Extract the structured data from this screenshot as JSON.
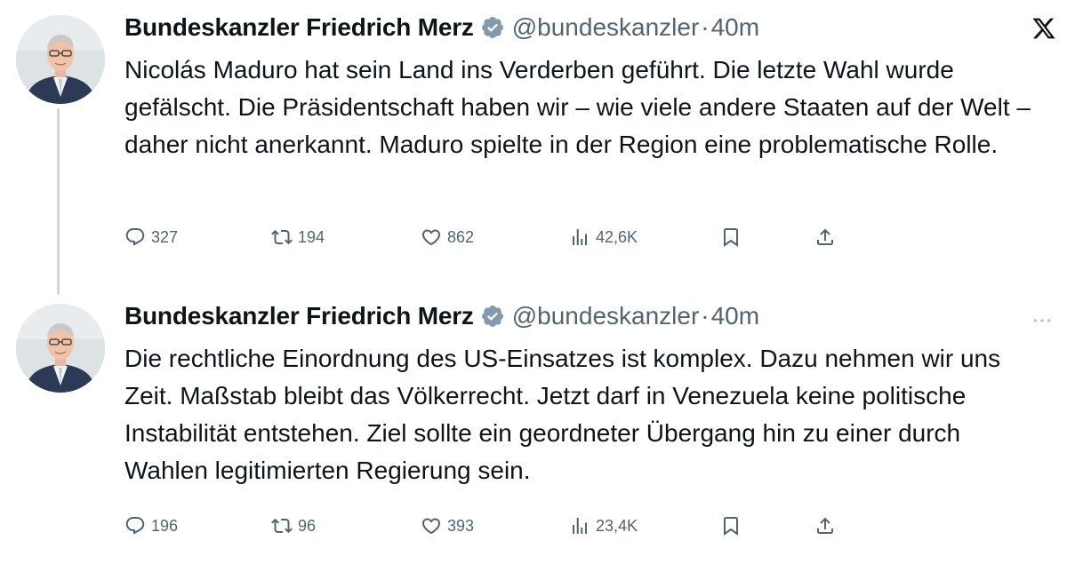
{
  "tweets": [
    {
      "author": {
        "display_name": "Bundeskanzler Friedrich Merz",
        "handle": "@bundeskanzler",
        "verified": true,
        "verified_color": "#829aab"
      },
      "separator": "·",
      "time": "40m",
      "corner_icon": "x-logo-icon",
      "text": "Nicolás Maduro hat sein Land ins Verderben geführt. Die letzte Wahl wurde gefälscht. Die Präsidentschaft haben wir – wie viele andere Staaten auf der Welt – daher nicht anerkannt. Maduro spielte in der Region eine problematische Rolle.",
      "actions": {
        "replies": "327",
        "retweets": "194",
        "likes": "862",
        "views": "42,6K"
      }
    },
    {
      "author": {
        "display_name": "Bundeskanzler Friedrich Merz",
        "handle": "@bundeskanzler",
        "verified": true,
        "verified_color": "#829aab"
      },
      "separator": "·",
      "time": "40m",
      "corner_icon": "more-icon",
      "text": "Die rechtliche Einordnung des US-Einsatzes ist komplex. Dazu nehmen wir uns Zeit. Maßstab bleibt das Völkerrecht. Jetzt darf in Venezuela keine politische Instabilität entstehen. Ziel sollte ein geordneter Übergang hin zu einer durch Wahlen legitimierten Regierung sein.",
      "actions": {
        "replies": "196",
        "retweets": "96",
        "likes": "393",
        "views": "23,4K"
      }
    }
  ],
  "colors": {
    "text": "#0f1419",
    "secondary": "#536471",
    "thread_line": "#cfd9de"
  }
}
